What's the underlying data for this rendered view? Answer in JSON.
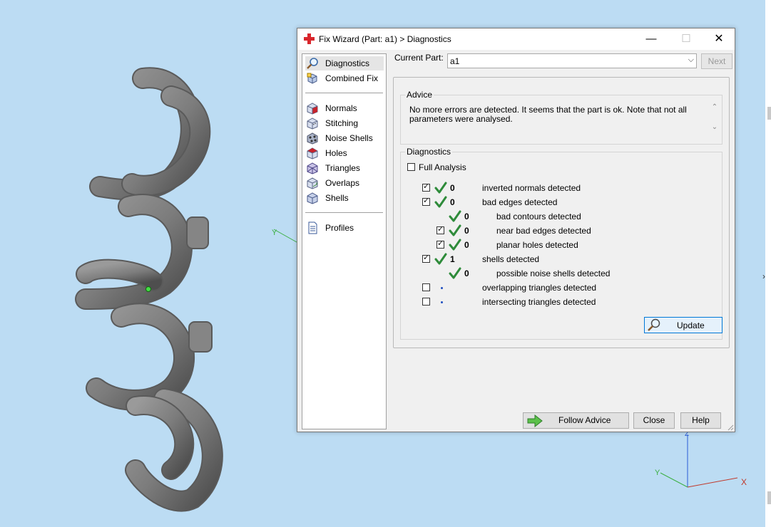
{
  "window": {
    "title": "Fix Wizard (Part: a1) > Diagnostics",
    "minimize_glyph": "—",
    "maximize_glyph": "☐",
    "close_glyph": "✕"
  },
  "sidebar": {
    "items": [
      {
        "label": "Diagnostics",
        "icon": "magnifier-icon",
        "active": true
      },
      {
        "label": "Combined Fix",
        "icon": "combined-fix-icon"
      },
      {
        "label": "Normals",
        "icon": "normals-cube-icon"
      },
      {
        "label": "Stitching",
        "icon": "stitching-cube-icon"
      },
      {
        "label": "Noise Shells",
        "icon": "noise-shells-icon"
      },
      {
        "label": "Holes",
        "icon": "holes-cube-icon"
      },
      {
        "label": "Triangles",
        "icon": "triangles-cube-icon"
      },
      {
        "label": "Overlaps",
        "icon": "overlaps-cube-icon"
      },
      {
        "label": "Shells",
        "icon": "shells-cube-icon"
      },
      {
        "label": "Profiles",
        "icon": "document-icon"
      }
    ]
  },
  "header": {
    "current_part_label": "Current Part:",
    "current_part_value": "a1",
    "next_label": "Next"
  },
  "advice": {
    "title": "Advice",
    "text": "No more errors are detected. It seems that the part is ok. Note that not all parameters were analysed."
  },
  "diagnostics": {
    "title": "Diagnostics",
    "full_analysis_label": "Full Analysis",
    "full_analysis_checked": false,
    "rows": [
      {
        "label": "inverted normals detected",
        "count": "0",
        "checked": true,
        "status": "ok"
      },
      {
        "label": "bad edges detected",
        "count": "0",
        "checked": true,
        "status": "ok"
      },
      {
        "label": "bad contours detected",
        "count": "0",
        "status": "ok"
      },
      {
        "label": "near bad edges detected",
        "count": "0",
        "checked": true,
        "status": "ok"
      },
      {
        "label": "planar holes detected",
        "count": "0",
        "checked": true,
        "status": "ok"
      },
      {
        "label": "shells detected",
        "count": "1",
        "checked": true,
        "status": "ok"
      },
      {
        "label": "possible noise shells detected",
        "count": "0",
        "status": "ok"
      },
      {
        "label": "overlapping triangles detected",
        "checked": false,
        "status": "not-analysed"
      },
      {
        "label": "intersecting triangles detected",
        "checked": false,
        "status": "not-analysed"
      }
    ],
    "update_label": "Update"
  },
  "footer": {
    "follow_advice_label": "Follow Advice",
    "close_label": "Close",
    "help_label": "Help"
  },
  "viewport": {
    "axes": {
      "x": "X",
      "y": "Y",
      "z": "Z"
    },
    "background": "#bcdcf3"
  },
  "colors": {
    "check_green": "#2e8b3a",
    "accent_blue": "#0078d7",
    "axis_x": "#c0392b",
    "axis_y": "#3cb043",
    "axis_z": "#2a5bd7"
  }
}
